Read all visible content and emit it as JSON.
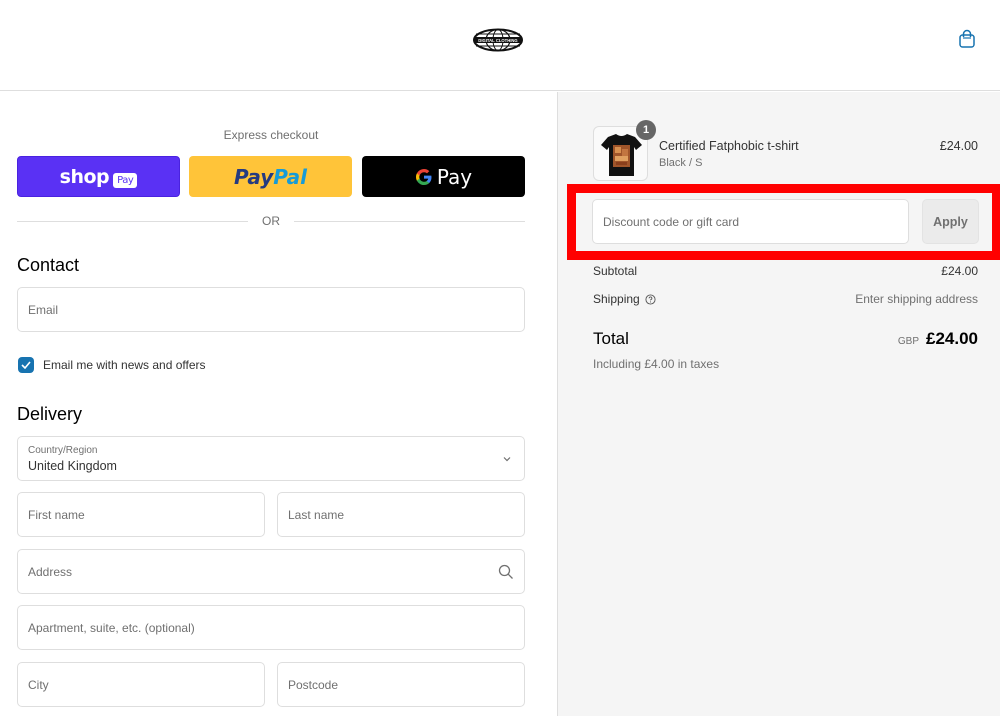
{
  "header": {
    "logo_alt": "Digital Clothing",
    "logo_text": "DIGITAL CLOTHING",
    "cart_icon": "shopping-bag-icon"
  },
  "express_checkout": {
    "label": "Express checkout",
    "buttons": [
      {
        "name": "Shop Pay",
        "text": "shop",
        "badge": "Pay",
        "color": "#5a31f4"
      },
      {
        "name": "PayPal",
        "text_part1": "Pay",
        "text_part2": "Pal",
        "color": "#ffc439"
      },
      {
        "name": "Google Pay",
        "text": "Pay",
        "color": "#000000"
      }
    ],
    "divider": "OR"
  },
  "contact": {
    "heading": "Contact",
    "email_placeholder": "Email",
    "newsletter_label": "Email me with news and offers",
    "newsletter_checked": true
  },
  "delivery": {
    "heading": "Delivery",
    "country_label": "Country/Region",
    "country_value": "United Kingdom",
    "first_name_placeholder": "First name",
    "last_name_placeholder": "Last name",
    "address_placeholder": "Address",
    "apartment_placeholder": "Apartment, suite, etc. (optional)",
    "city_placeholder": "City",
    "postcode_placeholder": "Postcode"
  },
  "order_summary": {
    "item": {
      "name": "Certified Fatphobic t-shirt",
      "variant": "Black / S",
      "price": "£24.00",
      "quantity": "1"
    },
    "discount_placeholder": "Discount code or gift card",
    "apply_label": "Apply",
    "subtotal_label": "Subtotal",
    "subtotal_value": "£24.00",
    "shipping_label": "Shipping",
    "shipping_value": "Enter shipping address",
    "total_label": "Total",
    "total_currency": "GBP",
    "total_value": "£24.00",
    "tax_note": "Including £4.00 in taxes"
  },
  "colors": {
    "accent": "#1773b0",
    "highlight": "#ff0000"
  }
}
